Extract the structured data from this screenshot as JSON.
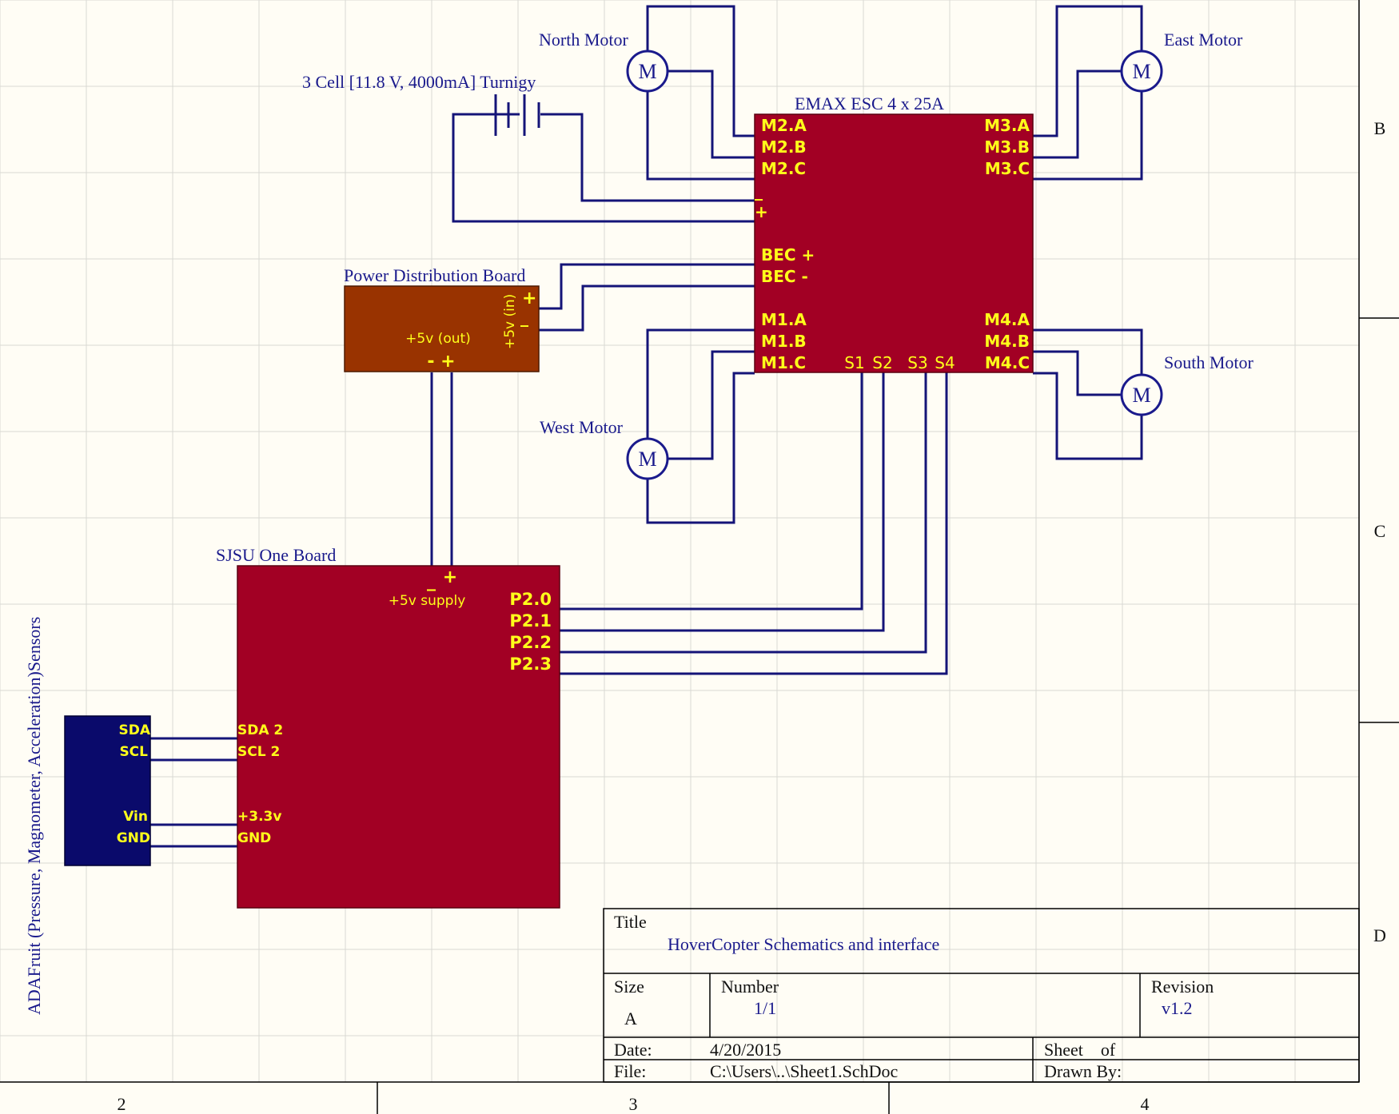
{
  "colors": {
    "background": "#fffdf5",
    "board": "#a20024",
    "pdb": "#993300",
    "sensor": "#0a0a6b",
    "pin_text": "#ffff1a",
    "wire": "#141478",
    "motor": "#1a1a8c"
  },
  "labels": {
    "north_motor": "North Motor",
    "east_motor": "East Motor",
    "south_motor": "South Motor",
    "west_motor": "West Motor",
    "battery": "3 Cell [11.8 V, 4000mA] Turnigy",
    "esc": "EMAX ESC 4 x 25A",
    "pdb": "Power Distribution Board",
    "sjsu": "SJSU One Board",
    "sensors": "ADAFruit (Pressure, Magnometer, Acceleration)Sensors",
    "motor_symbol": "M"
  },
  "esc_pins": {
    "m2a": "M2.A",
    "m2b": "M2.B",
    "m2c": "M2.C",
    "m3a": "M3.A",
    "m3b": "M3.B",
    "m3c": "M3.C",
    "minus": "_",
    "plus": "+",
    "bec_plus": "BEC +",
    "bec_minus": "BEC -",
    "m1a": "M1.A",
    "m1b": "M1.B",
    "m1c": "M1.C",
    "m4a": "M4.A",
    "m4b": "M4.B",
    "m4c": "M4.C",
    "s1": "S1",
    "s2": "S2",
    "s3": "S3",
    "s4": "S4"
  },
  "pdb_pins": {
    "plus_in": "+",
    "minus_in": "_",
    "in_label": "+5v (in)",
    "out_label": "+5v (out)",
    "out_pins": "- +"
  },
  "sjsu_pins": {
    "minus": "_",
    "plus": "+",
    "supply": "+5v supply",
    "p20": "P2.0",
    "p21": "P2.1",
    "p22": "P2.2",
    "p23": "P2.3",
    "sda2": "SDA 2",
    "scl2": "SCL 2",
    "v33": "+3.3v",
    "gnd": "GND"
  },
  "sensor_pins": {
    "sda": "SDA",
    "scl": "SCL",
    "vin": "Vin",
    "gnd": "GND"
  },
  "title_block": {
    "title_label": "Title",
    "title_value": "HoverCopter Schematics and interface",
    "size_label": "Size",
    "size_value": "A",
    "number_label": "Number",
    "number_value": "1/1",
    "revision_label": "Revision",
    "revision_value": "v1.2",
    "date_label": "Date:",
    "date_value": "4/20/2015",
    "file_label": "File:",
    "file_value": "C:\\Users\\..\\Sheet1.SchDoc",
    "sheet_label": "Sheet    of",
    "drawn_label": "Drawn By:"
  },
  "zones": {
    "rows": [
      "B",
      "C",
      "D"
    ],
    "cols": [
      "2",
      "3",
      "4"
    ]
  }
}
